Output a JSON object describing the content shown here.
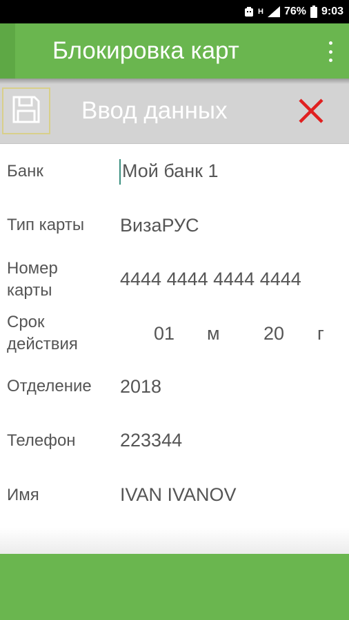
{
  "status_bar": {
    "battery": "76%",
    "time": "9:03"
  },
  "app_bar": {
    "title": "Блокировка карт"
  },
  "toolbar": {
    "title": "Ввод данных"
  },
  "colors": {
    "app_bar": "#6ab64f",
    "toolbar": "#d3d3d3",
    "close_icon": "#e02020",
    "text": "#555555"
  },
  "form": {
    "bank": {
      "label": "Банк",
      "value": "Мой банк 1"
    },
    "card_type": {
      "label": "Тип карты",
      "value": "ВизаРУС"
    },
    "card_number": {
      "label_line1": "Номер",
      "label_line2": "карты",
      "value": "4444 4444 4444 4444"
    },
    "expiry": {
      "label_line1": "Срок",
      "label_line2": "действия",
      "month": "01",
      "month_unit": "м",
      "year": "20",
      "year_unit": "г"
    },
    "branch": {
      "label": "Отделение",
      "value": "2018"
    },
    "phone": {
      "label": "Телефон",
      "value": "223344"
    },
    "name": {
      "label": "Имя",
      "value": "IVAN IVANOV"
    }
  },
  "icons": {
    "save": "floppy-disk-icon",
    "close": "close-icon",
    "menu": "overflow-menu-icon"
  }
}
